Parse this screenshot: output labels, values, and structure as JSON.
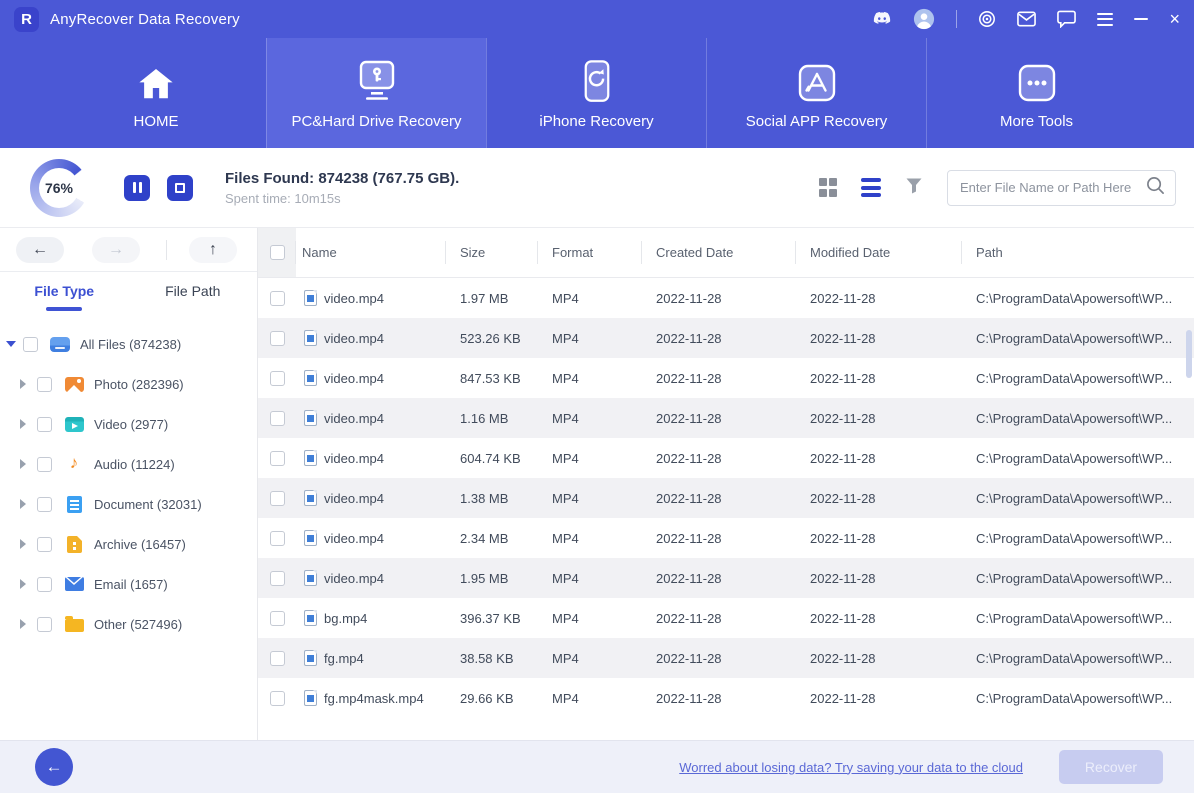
{
  "titlebar": {
    "app_title": "AnyRecover Data Recovery",
    "logo_letter": "R",
    "close_glyph": "×",
    "icons": [
      "discord-icon",
      "user-avatar",
      "record-icon",
      "mail-icon",
      "feedback-icon",
      "menu-icon",
      "minimize-icon",
      "close-icon"
    ]
  },
  "nav": {
    "tabs": [
      {
        "label": "HOME",
        "icon": "home-icon",
        "active": false
      },
      {
        "label": "PC&Hard Drive Recovery",
        "icon": "pc-recovery-icon",
        "active": true
      },
      {
        "label": "iPhone Recovery",
        "icon": "iphone-recovery-icon",
        "active": false
      },
      {
        "label": "Social APP Recovery",
        "icon": "social-app-recovery-icon",
        "active": false
      },
      {
        "label": "More Tools",
        "icon": "more-tools-icon",
        "active": false
      }
    ]
  },
  "scan": {
    "progress_percent": "76%",
    "files_found": "Files Found: 874238 (767.75 GB).",
    "spent_time": "Spent time: 10m15s"
  },
  "view_controls": {
    "icons": [
      "grid-view-icon",
      "list-view-icon",
      "filter-icon"
    ],
    "search_placeholder": "Enter File Name or Path Here"
  },
  "sidebar": {
    "nav_arrows": {
      "back": "←",
      "forward": "→",
      "up": "↑"
    },
    "tabs": [
      {
        "label": "File Type",
        "active": true
      },
      {
        "label": "File Path",
        "active": false
      }
    ],
    "tree": [
      {
        "label": "All Files (874238)",
        "icon": "all-files-icon",
        "state": "expanded",
        "level": "root"
      },
      {
        "label": "Photo (282396)",
        "icon": "photo-icon",
        "state": "collapsed",
        "level": "child"
      },
      {
        "label": "Video (2977)",
        "icon": "video-icon",
        "state": "collapsed",
        "level": "child"
      },
      {
        "label": "Audio (11224)",
        "icon": "audio-icon",
        "state": "collapsed",
        "level": "child"
      },
      {
        "label": "Document (32031)",
        "icon": "document-icon",
        "state": "collapsed",
        "level": "child"
      },
      {
        "label": "Archive (16457)",
        "icon": "archive-icon",
        "state": "collapsed",
        "level": "child"
      },
      {
        "label": "Email (1657)",
        "icon": "email-icon",
        "state": "collapsed",
        "level": "child"
      },
      {
        "label": "Other (527496)",
        "icon": "other-icon",
        "state": "collapsed",
        "level": "child"
      }
    ]
  },
  "table": {
    "columns": [
      "Name",
      "Size",
      "Format",
      "Created Date",
      "Modified Date",
      "Path"
    ],
    "rows": [
      {
        "name": "video.mp4",
        "size": "1.97 MB",
        "format": "MP4",
        "created": "2022-11-28",
        "modified": "2022-11-28",
        "path": "C:\\ProgramData\\Apowersoft\\WP..."
      },
      {
        "name": "video.mp4",
        "size": "523.26 KB",
        "format": "MP4",
        "created": "2022-11-28",
        "modified": "2022-11-28",
        "path": "C:\\ProgramData\\Apowersoft\\WP..."
      },
      {
        "name": "video.mp4",
        "size": "847.53 KB",
        "format": "MP4",
        "created": "2022-11-28",
        "modified": "2022-11-28",
        "path": "C:\\ProgramData\\Apowersoft\\WP..."
      },
      {
        "name": "video.mp4",
        "size": "1.16 MB",
        "format": "MP4",
        "created": "2022-11-28",
        "modified": "2022-11-28",
        "path": "C:\\ProgramData\\Apowersoft\\WP..."
      },
      {
        "name": "video.mp4",
        "size": "604.74 KB",
        "format": "MP4",
        "created": "2022-11-28",
        "modified": "2022-11-28",
        "path": "C:\\ProgramData\\Apowersoft\\WP..."
      },
      {
        "name": "video.mp4",
        "size": "1.38 MB",
        "format": "MP4",
        "created": "2022-11-28",
        "modified": "2022-11-28",
        "path": "C:\\ProgramData\\Apowersoft\\WP..."
      },
      {
        "name": "video.mp4",
        "size": "2.34 MB",
        "format": "MP4",
        "created": "2022-11-28",
        "modified": "2022-11-28",
        "path": "C:\\ProgramData\\Apowersoft\\WP..."
      },
      {
        "name": "video.mp4",
        "size": "1.95 MB",
        "format": "MP4",
        "created": "2022-11-28",
        "modified": "2022-11-28",
        "path": "C:\\ProgramData\\Apowersoft\\WP..."
      },
      {
        "name": "bg.mp4",
        "size": "396.37 KB",
        "format": "MP4",
        "created": "2022-11-28",
        "modified": "2022-11-28",
        "path": "C:\\ProgramData\\Apowersoft\\WP..."
      },
      {
        "name": "fg.mp4",
        "size": "38.58 KB",
        "format": "MP4",
        "created": "2022-11-28",
        "modified": "2022-11-28",
        "path": "C:\\ProgramData\\Apowersoft\\WP..."
      },
      {
        "name": "fg.mp4mask.mp4",
        "size": "29.66 KB",
        "format": "MP4",
        "created": "2022-11-28",
        "modified": "2022-11-28",
        "path": "C:\\ProgramData\\Apowersoft\\WP..."
      }
    ]
  },
  "footer": {
    "cloud_link": "Worred about losing data? Try saving your data to the cloud",
    "recover_label": "Recover"
  },
  "colors": {
    "accent": "#4b58d6",
    "accent_dark": "#2f41c9",
    "active_tab": "#5b67de",
    "link": "#5a68d6",
    "alt_row": "#f1f1f4"
  }
}
